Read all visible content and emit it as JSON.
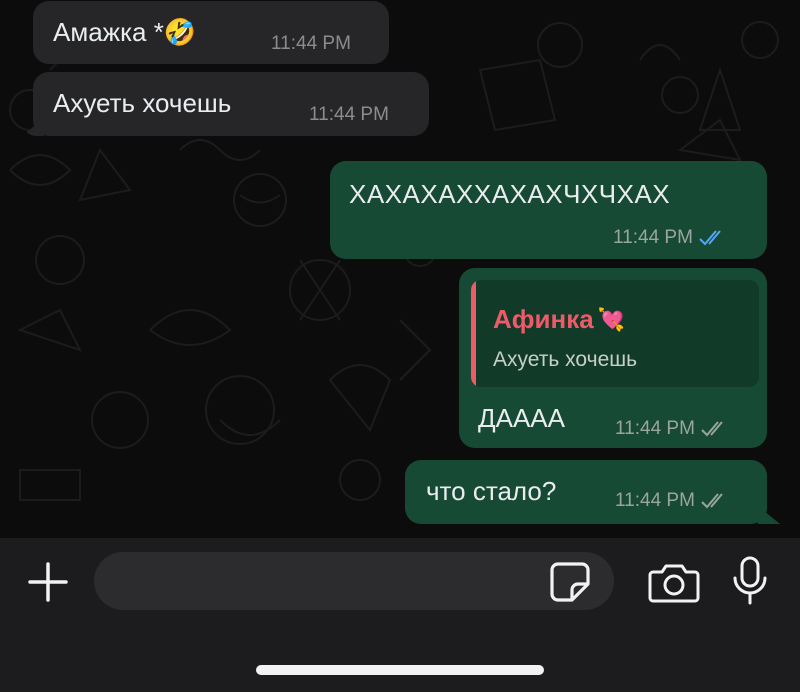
{
  "messages": [
    {
      "direction": "incoming",
      "text": "Амажка *",
      "emoji": "🤣",
      "time": "11:44 PM"
    },
    {
      "direction": "incoming",
      "text": "Ахуеть хочешь",
      "time": "11:44 PM"
    },
    {
      "direction": "outgoing",
      "text": "ХАХАХАХХАХАХЧХЧХАХ",
      "time": "11:44 PM",
      "status": "read"
    },
    {
      "direction": "outgoing",
      "text": "ДАААА",
      "time": "11:44 PM",
      "status": "delivered",
      "reply_to": {
        "sender": "Афинка",
        "sender_emoji": "💘",
        "text": "Ахуеть хочешь"
      }
    },
    {
      "direction": "outgoing",
      "text": "что стало?",
      "time": "11:44 PM",
      "status": "delivered"
    }
  ],
  "composer": {
    "placeholder": ""
  },
  "colors": {
    "incoming_bubble": "#262628",
    "outgoing_bubble": "#174a34",
    "reply_accent": "#ef5a68",
    "read_tick": "#53a6f8",
    "background": "#0c0c0c"
  },
  "icons": [
    "plus-icon",
    "sticker-icon",
    "camera-icon",
    "microphone-icon",
    "double-check-icon"
  ]
}
